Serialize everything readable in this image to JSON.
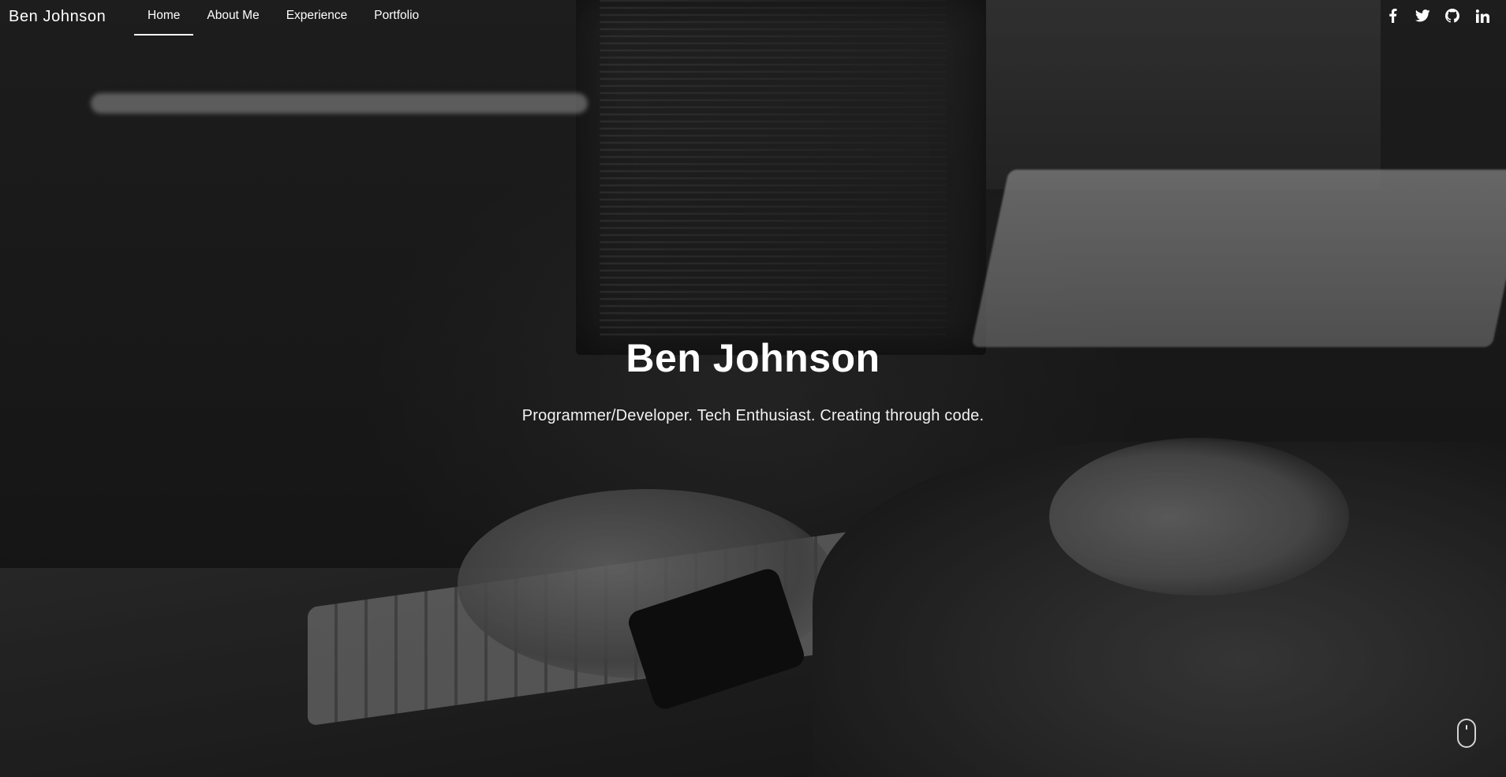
{
  "brand": {
    "name": "Ben Johnson"
  },
  "nav": {
    "items": [
      {
        "label": "Home",
        "active": true
      },
      {
        "label": "About Me",
        "active": false
      },
      {
        "label": "Experience",
        "active": false
      },
      {
        "label": "Portfolio",
        "active": false
      }
    ]
  },
  "socials": [
    {
      "icon": "facebook-icon"
    },
    {
      "icon": "twitter-icon"
    },
    {
      "icon": "github-icon"
    },
    {
      "icon": "linkedin-icon"
    }
  ],
  "hero": {
    "title": "Ben Johnson",
    "subtitle": "Programmer/Developer. Tech Enthusiast. Creating through code.",
    "scroll_icon": "mouse-scroll-icon"
  }
}
